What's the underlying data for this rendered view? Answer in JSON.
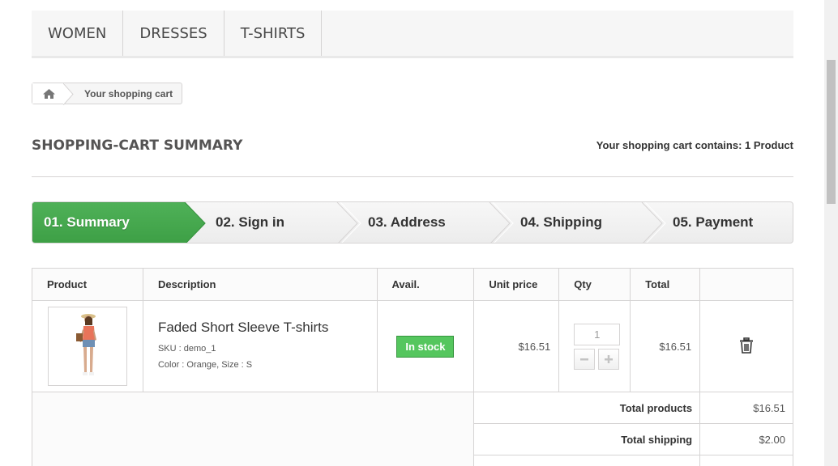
{
  "nav": {
    "items": [
      "WOMEN",
      "DRESSES",
      "T-SHIRTS"
    ]
  },
  "breadcrumb": {
    "home_icon": "home-icon",
    "current": "Your shopping cart"
  },
  "page": {
    "heading": "SHOPPING-CART SUMMARY",
    "cart_count_label": "Your shopping cart contains:",
    "cart_count_value": "1 Product"
  },
  "steps": [
    {
      "label": "01. Summary",
      "active": true
    },
    {
      "label": "02. Sign in",
      "active": false
    },
    {
      "label": "03. Address",
      "active": false
    },
    {
      "label": "04. Shipping",
      "active": false
    },
    {
      "label": "05. Payment",
      "active": false
    }
  ],
  "colors": {
    "active_step": "#46a74e",
    "in_stock": "#55c65e",
    "border": "#d6d4d4"
  },
  "table": {
    "headers": {
      "product": "Product",
      "description": "Description",
      "avail": "Avail.",
      "unit_price": "Unit price",
      "qty": "Qty",
      "total": "Total"
    },
    "rows": [
      {
        "name": "Faded Short Sleeve T-shirts",
        "sku": "SKU : demo_1",
        "attributes": "Color : Orange, Size : S",
        "availability": "In stock",
        "unit_price": "$16.51",
        "qty": "1",
        "total": "$16.51",
        "delete_icon": "trash-icon"
      }
    ],
    "summary": [
      {
        "label": "Total products",
        "value": "$16.51"
      },
      {
        "label": "Total shipping",
        "value": "$2.00"
      }
    ]
  }
}
